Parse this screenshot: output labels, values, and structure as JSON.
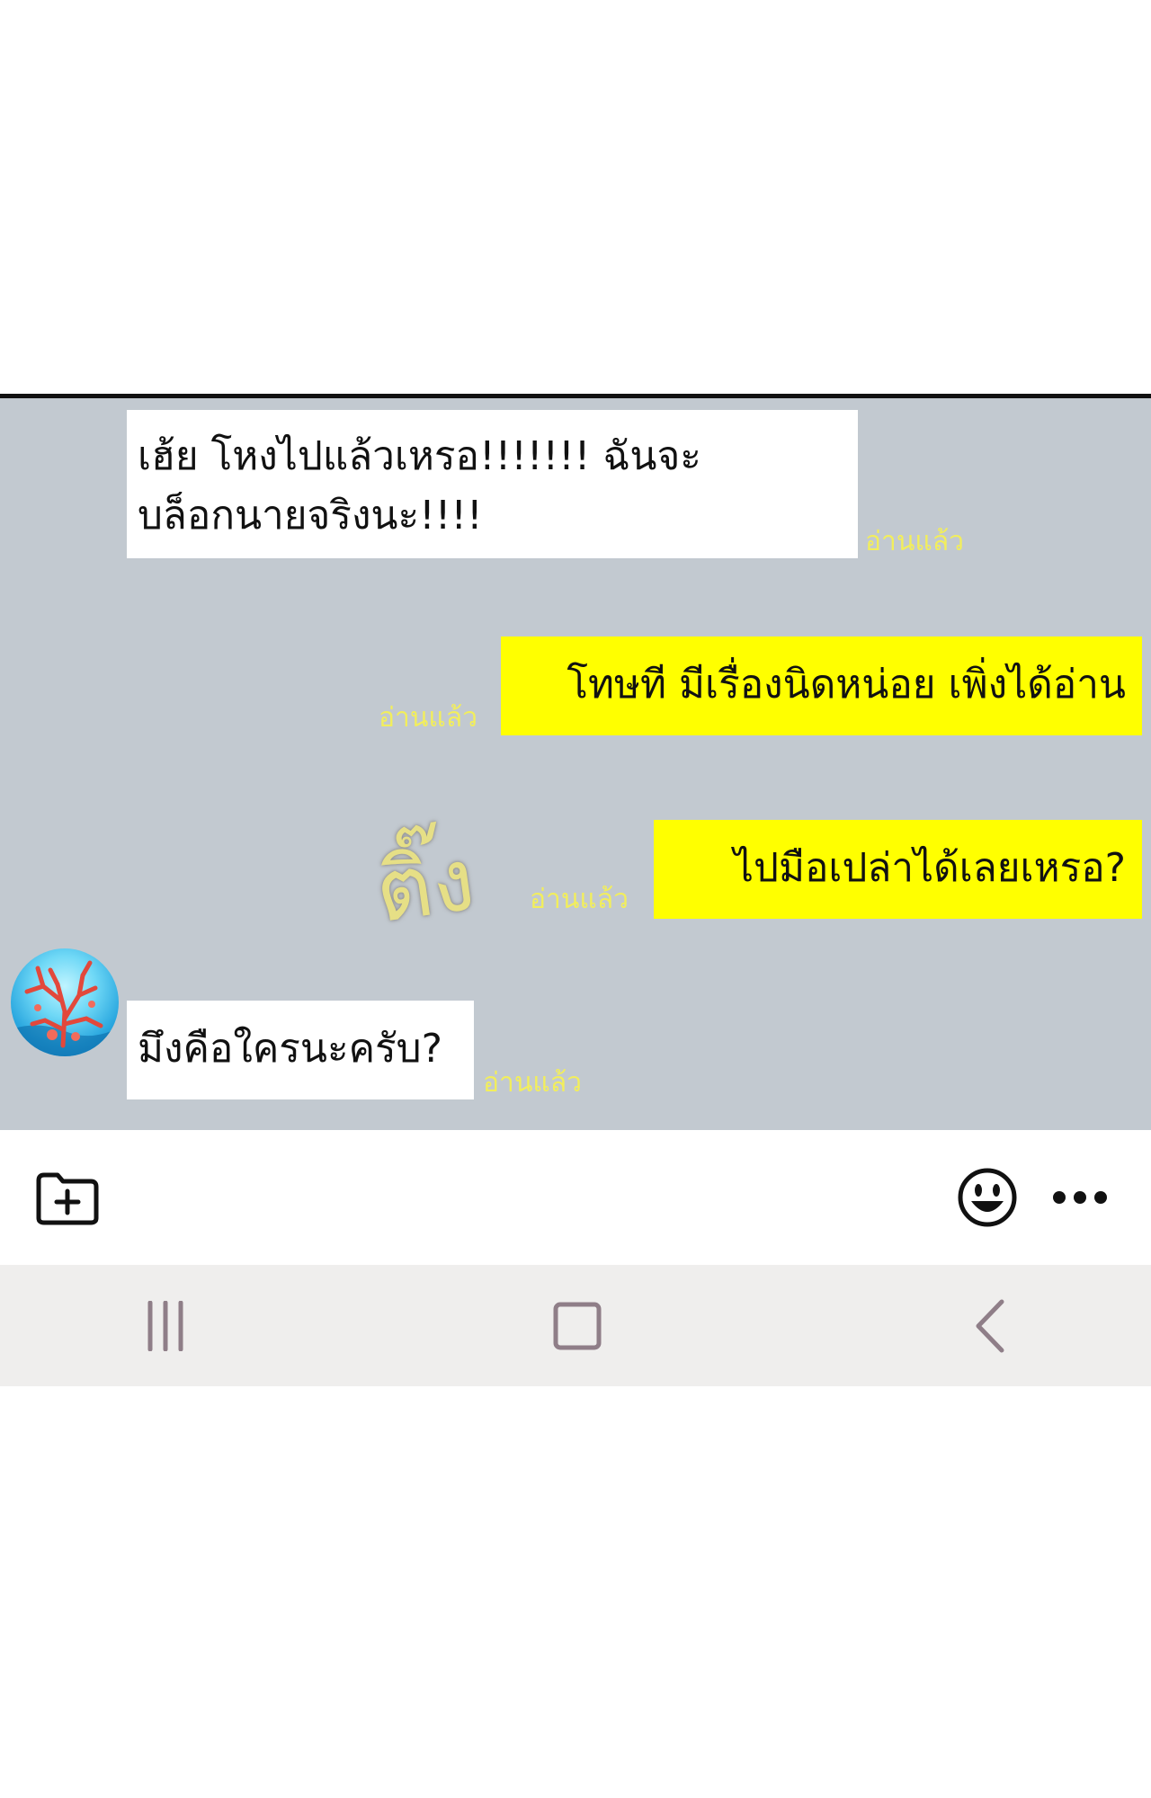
{
  "messages": [
    {
      "text": "เฮ้ย โหงไปแล้วเหรอ!!!!!!! ฉันจะ\nบล็อกนายจริงนะ!!!!",
      "read": "อ่านแล้ว"
    },
    {
      "text": "โทษที มีเรื่องนิดหน่อย เพิ่งได้อ่าน",
      "read": "อ่านแล้ว"
    },
    {
      "text": "ไปมือเปล่าได้เลยเหรอ?",
      "read": "อ่านแล้ว"
    },
    {
      "text": "มึงคือใครนะครับ?",
      "read": "อ่านแล้ว"
    }
  ],
  "sound_effect": "ติ๊ง",
  "toolbar": {
    "attach_icon": "folder-plus-icon",
    "emoji_icon": "smiley-icon",
    "more_icon": "more-dots-icon"
  },
  "nav": {
    "recents_icon": "recent-apps-icon",
    "home_icon": "home-square-icon",
    "back_icon": "back-chevron-icon"
  },
  "colors": {
    "chat_background": "#c2c9d0",
    "outgoing_bubble": "#ffff00",
    "incoming_bubble": "#ffffff",
    "read_receipt": "#f2ee5c",
    "nav_bar": "#efeeed"
  }
}
